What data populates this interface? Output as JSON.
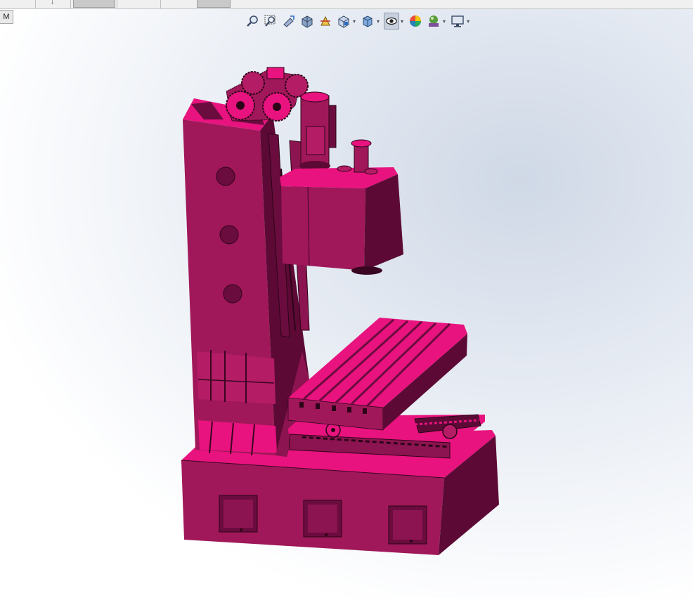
{
  "window": {
    "mode_tab_label": "M"
  },
  "heads_up_toolbar": [
    {
      "name": "zoom-to-fit-icon"
    },
    {
      "name": "zoom-to-area-icon"
    },
    {
      "name": "previous-view-icon"
    },
    {
      "name": "section-view-icon"
    },
    {
      "name": "dynamic-annotation-view-icon"
    },
    {
      "name": "view-orientation-icon",
      "dropdown": true
    },
    {
      "name": "display-style-icon",
      "dropdown": true
    },
    {
      "name": "hide-show-items-icon",
      "dropdown": true,
      "active": true
    },
    {
      "name": "edit-appearance-icon"
    },
    {
      "name": "apply-scene-icon",
      "dropdown": true
    },
    {
      "name": "view-settings-icon",
      "dropdown": true
    }
  ],
  "model": {
    "part_color": "#a0185a",
    "highlight_color": "#e8137e",
    "shadow_color": "#5c0a35"
  }
}
